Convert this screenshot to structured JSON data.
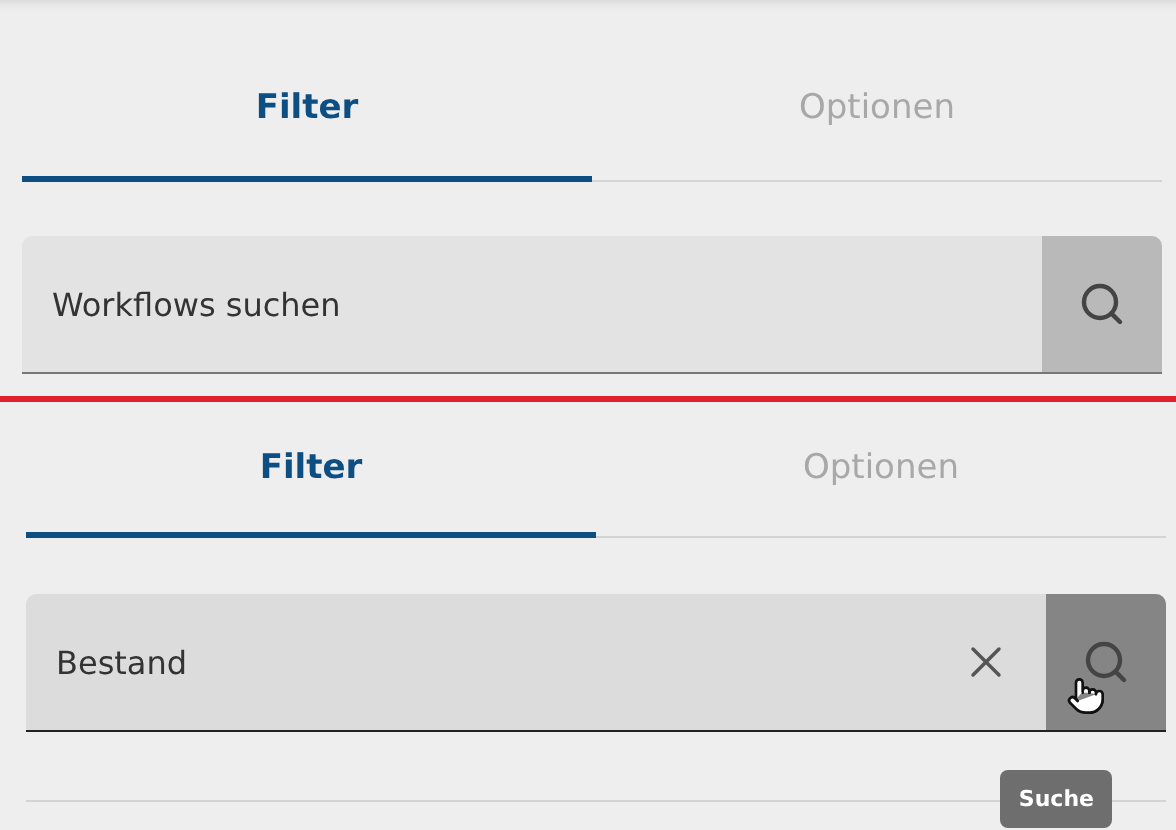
{
  "panels": [
    {
      "tabs": [
        {
          "label": "Filter",
          "selected": true
        },
        {
          "label": "Optionen",
          "selected": false
        }
      ],
      "search": {
        "placeholder": "Workflows suchen",
        "button_hovered": false
      }
    },
    {
      "tabs": [
        {
          "label": "Filter",
          "selected": true
        },
        {
          "label": "Optionen",
          "selected": false
        }
      ],
      "search": {
        "value": "Bestand",
        "clearable": true,
        "button_hovered": true
      },
      "tooltip": "Suche"
    }
  ]
}
